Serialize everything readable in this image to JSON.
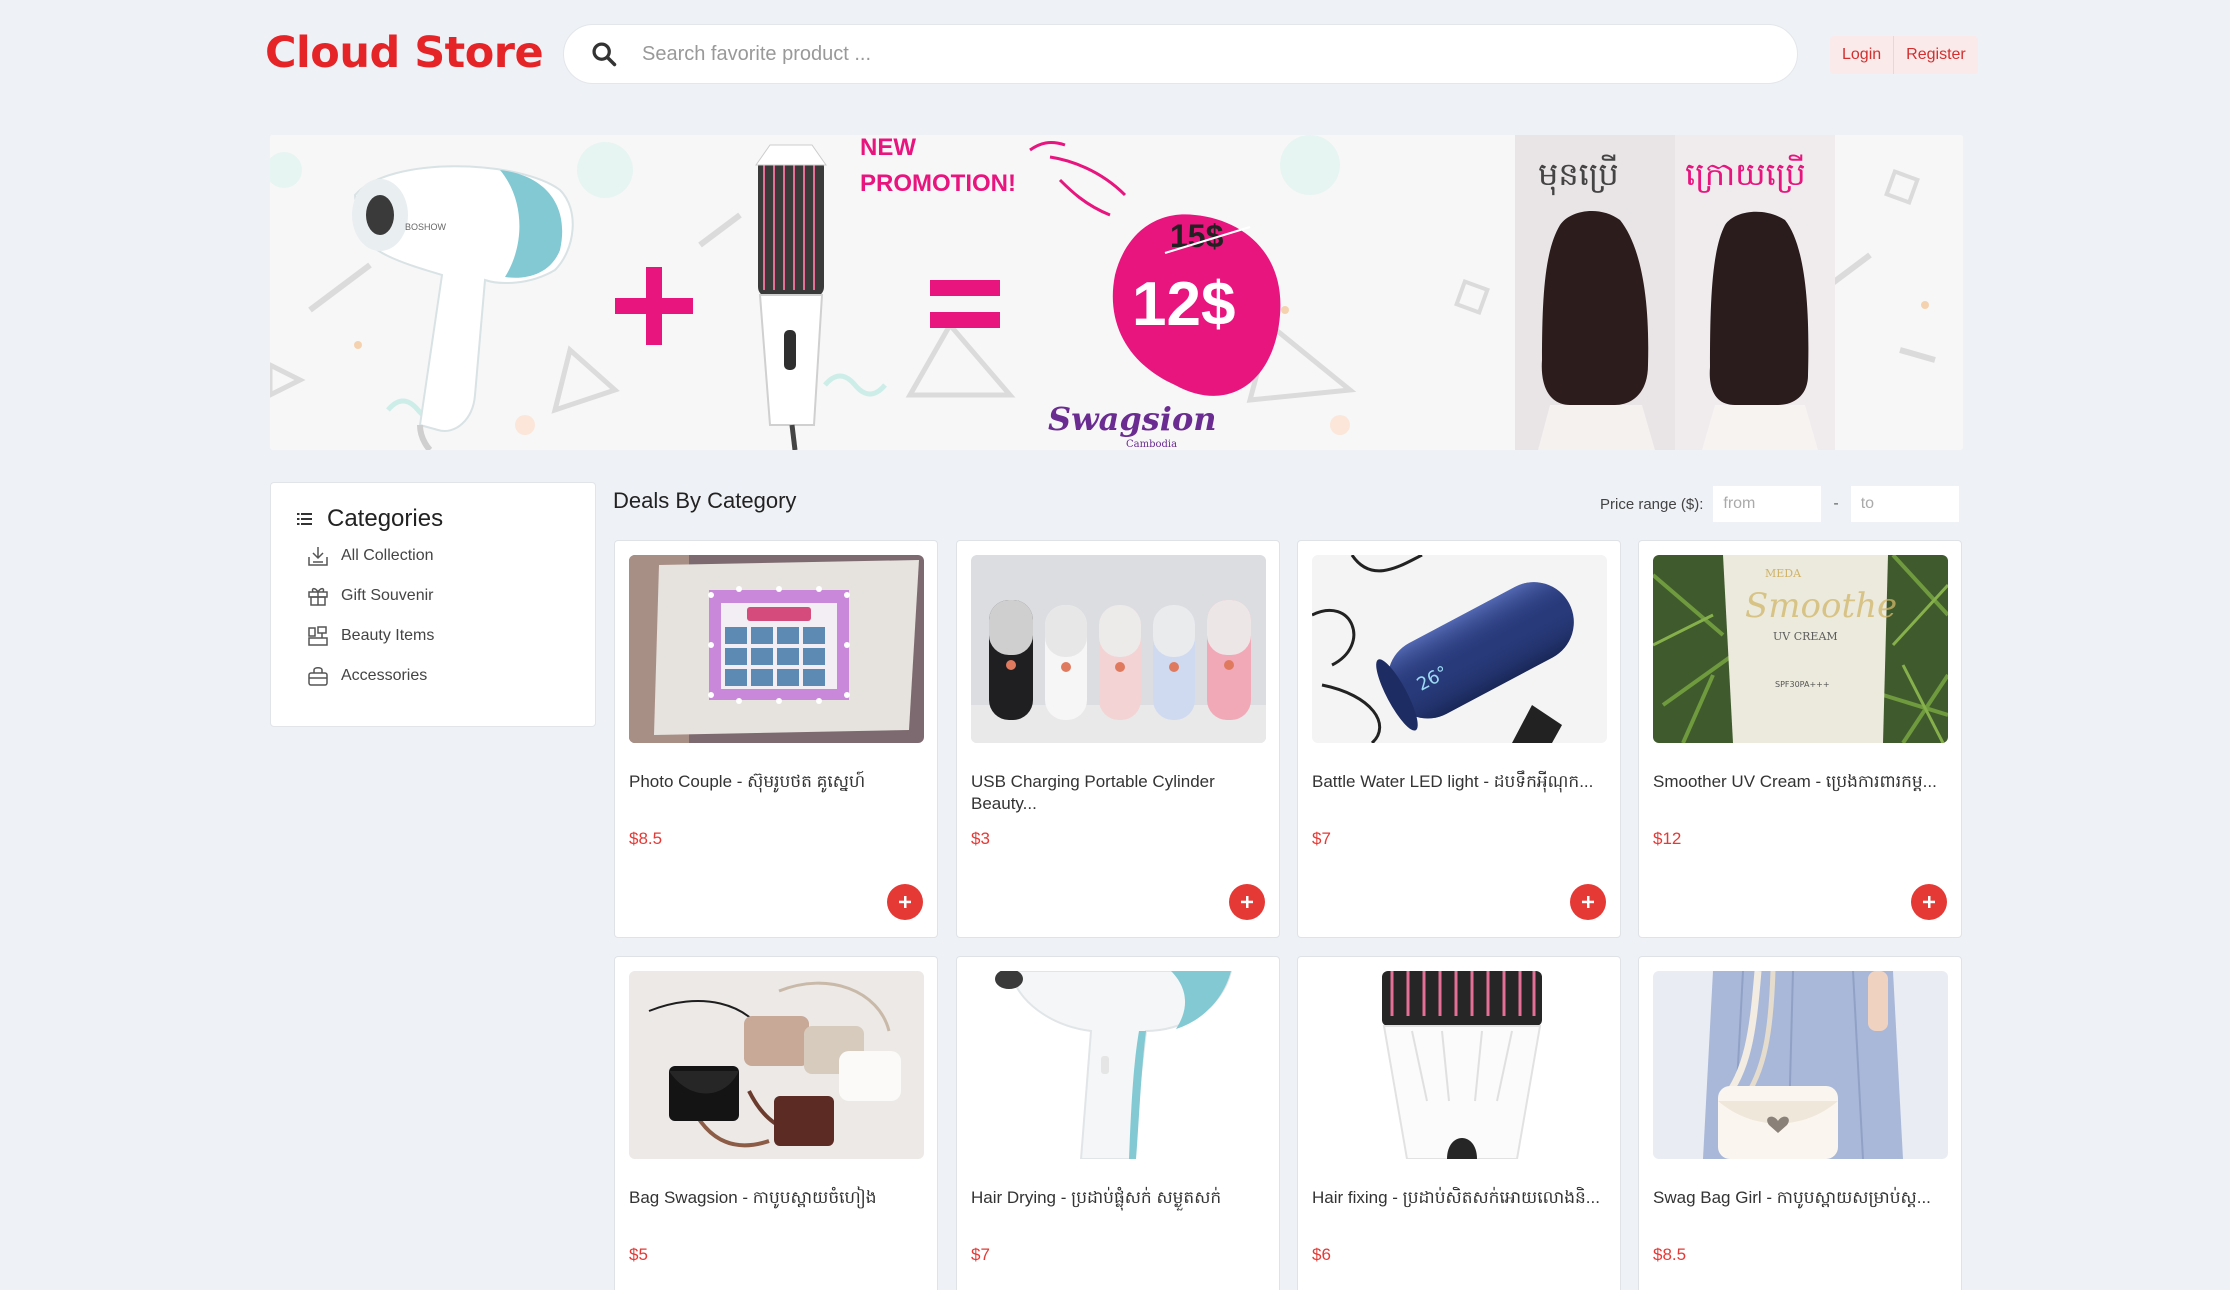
{
  "header": {
    "logo": "Cloud Store",
    "search_placeholder": "Search favorite product ...",
    "login_label": "Login",
    "register_label": "Register"
  },
  "banner": {
    "new_label": "NEW",
    "promotion_label": "PROMOTION!",
    "old_price": "15$",
    "new_price": "12$",
    "brand": "Swagsion",
    "brand_sub": "Cambodia",
    "before_label": "មុនប្រើ",
    "after_label": "ក្រោយប្រើ",
    "device_brand": "BOSHOW"
  },
  "sidebar": {
    "title": "Categories",
    "items": [
      {
        "label": "All Collection",
        "icon": "download-tray-icon"
      },
      {
        "label": "Gift Souvenir",
        "icon": "gift-icon"
      },
      {
        "label": "Beauty Items",
        "icon": "beauty-items-icon"
      },
      {
        "label": "Accessories",
        "icon": "bag-icon"
      }
    ]
  },
  "deals": {
    "title": "Deals By Category",
    "price_range_label": "Price range ($):",
    "from_placeholder": "from",
    "to_placeholder": "to",
    "dash": "-"
  },
  "products": [
    {
      "name": "Photo Couple - ស៊ុមរូបថត គូស្នេហ៍",
      "price": "$8.5",
      "image": "photo-frame"
    },
    {
      "name": "USB Charging Portable Cylinder Beauty...",
      "price": "$3",
      "image": "nano-mist-sprayers"
    },
    {
      "name": "Battle Water LED light - ដបទឹកអុីណុក...",
      "price": "$7",
      "image": "blue-bottle"
    },
    {
      "name": "Smoother UV Cream - ប្រេងការពារកម្ត...",
      "price": "$12",
      "image": "uv-cream"
    },
    {
      "name": "Bag Swagsion - កាបូបស្ពាយចំហៀង",
      "price": "$5",
      "image": "bags"
    },
    {
      "name": "Hair Drying - ប្រដាប់ផ្លុំសក់ សម្ងួតសក់",
      "price": "$7",
      "image": "hair-dryer"
    },
    {
      "name": "Hair fixing - ប្រដាប់សិតសក់អោយលោងនិ...",
      "price": "$6",
      "image": "hair-brush"
    },
    {
      "name": "Swag Bag Girl - កាបូបស្ពាយសម្រាប់ស្ត...",
      "price": "$8.5",
      "image": "white-bag"
    }
  ],
  "colors": {
    "brand_red": "#e52428",
    "price_red": "#e53935",
    "promo_pink": "#e8157f",
    "brand_purple": "#6a2c91"
  }
}
